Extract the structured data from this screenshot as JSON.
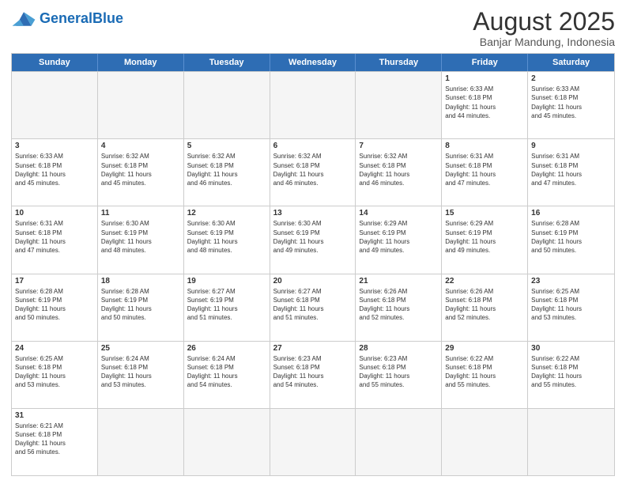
{
  "header": {
    "logo_general": "General",
    "logo_blue": "Blue",
    "calendar_title": "August 2025",
    "calendar_subtitle": "Banjar Mandung, Indonesia"
  },
  "days_of_week": [
    "Sunday",
    "Monday",
    "Tuesday",
    "Wednesday",
    "Thursday",
    "Friday",
    "Saturday"
  ],
  "weeks": [
    [
      {
        "day": "",
        "info": "",
        "empty": true
      },
      {
        "day": "",
        "info": "",
        "empty": true
      },
      {
        "day": "",
        "info": "",
        "empty": true
      },
      {
        "day": "",
        "info": "",
        "empty": true
      },
      {
        "day": "",
        "info": "",
        "empty": true
      },
      {
        "day": "1",
        "info": "Sunrise: 6:33 AM\nSunset: 6:18 PM\nDaylight: 11 hours\nand 44 minutes."
      },
      {
        "day": "2",
        "info": "Sunrise: 6:33 AM\nSunset: 6:18 PM\nDaylight: 11 hours\nand 45 minutes."
      }
    ],
    [
      {
        "day": "3",
        "info": "Sunrise: 6:33 AM\nSunset: 6:18 PM\nDaylight: 11 hours\nand 45 minutes."
      },
      {
        "day": "4",
        "info": "Sunrise: 6:32 AM\nSunset: 6:18 PM\nDaylight: 11 hours\nand 45 minutes."
      },
      {
        "day": "5",
        "info": "Sunrise: 6:32 AM\nSunset: 6:18 PM\nDaylight: 11 hours\nand 46 minutes."
      },
      {
        "day": "6",
        "info": "Sunrise: 6:32 AM\nSunset: 6:18 PM\nDaylight: 11 hours\nand 46 minutes."
      },
      {
        "day": "7",
        "info": "Sunrise: 6:32 AM\nSunset: 6:18 PM\nDaylight: 11 hours\nand 46 minutes."
      },
      {
        "day": "8",
        "info": "Sunrise: 6:31 AM\nSunset: 6:18 PM\nDaylight: 11 hours\nand 47 minutes."
      },
      {
        "day": "9",
        "info": "Sunrise: 6:31 AM\nSunset: 6:18 PM\nDaylight: 11 hours\nand 47 minutes."
      }
    ],
    [
      {
        "day": "10",
        "info": "Sunrise: 6:31 AM\nSunset: 6:18 PM\nDaylight: 11 hours\nand 47 minutes."
      },
      {
        "day": "11",
        "info": "Sunrise: 6:30 AM\nSunset: 6:19 PM\nDaylight: 11 hours\nand 48 minutes."
      },
      {
        "day": "12",
        "info": "Sunrise: 6:30 AM\nSunset: 6:19 PM\nDaylight: 11 hours\nand 48 minutes."
      },
      {
        "day": "13",
        "info": "Sunrise: 6:30 AM\nSunset: 6:19 PM\nDaylight: 11 hours\nand 49 minutes."
      },
      {
        "day": "14",
        "info": "Sunrise: 6:29 AM\nSunset: 6:19 PM\nDaylight: 11 hours\nand 49 minutes."
      },
      {
        "day": "15",
        "info": "Sunrise: 6:29 AM\nSunset: 6:19 PM\nDaylight: 11 hours\nand 49 minutes."
      },
      {
        "day": "16",
        "info": "Sunrise: 6:28 AM\nSunset: 6:19 PM\nDaylight: 11 hours\nand 50 minutes."
      }
    ],
    [
      {
        "day": "17",
        "info": "Sunrise: 6:28 AM\nSunset: 6:19 PM\nDaylight: 11 hours\nand 50 minutes."
      },
      {
        "day": "18",
        "info": "Sunrise: 6:28 AM\nSunset: 6:19 PM\nDaylight: 11 hours\nand 50 minutes."
      },
      {
        "day": "19",
        "info": "Sunrise: 6:27 AM\nSunset: 6:19 PM\nDaylight: 11 hours\nand 51 minutes."
      },
      {
        "day": "20",
        "info": "Sunrise: 6:27 AM\nSunset: 6:18 PM\nDaylight: 11 hours\nand 51 minutes."
      },
      {
        "day": "21",
        "info": "Sunrise: 6:26 AM\nSunset: 6:18 PM\nDaylight: 11 hours\nand 52 minutes."
      },
      {
        "day": "22",
        "info": "Sunrise: 6:26 AM\nSunset: 6:18 PM\nDaylight: 11 hours\nand 52 minutes."
      },
      {
        "day": "23",
        "info": "Sunrise: 6:25 AM\nSunset: 6:18 PM\nDaylight: 11 hours\nand 53 minutes."
      }
    ],
    [
      {
        "day": "24",
        "info": "Sunrise: 6:25 AM\nSunset: 6:18 PM\nDaylight: 11 hours\nand 53 minutes."
      },
      {
        "day": "25",
        "info": "Sunrise: 6:24 AM\nSunset: 6:18 PM\nDaylight: 11 hours\nand 53 minutes."
      },
      {
        "day": "26",
        "info": "Sunrise: 6:24 AM\nSunset: 6:18 PM\nDaylight: 11 hours\nand 54 minutes."
      },
      {
        "day": "27",
        "info": "Sunrise: 6:23 AM\nSunset: 6:18 PM\nDaylight: 11 hours\nand 54 minutes."
      },
      {
        "day": "28",
        "info": "Sunrise: 6:23 AM\nSunset: 6:18 PM\nDaylight: 11 hours\nand 55 minutes."
      },
      {
        "day": "29",
        "info": "Sunrise: 6:22 AM\nSunset: 6:18 PM\nDaylight: 11 hours\nand 55 minutes."
      },
      {
        "day": "30",
        "info": "Sunrise: 6:22 AM\nSunset: 6:18 PM\nDaylight: 11 hours\nand 55 minutes."
      }
    ],
    [
      {
        "day": "31",
        "info": "Sunrise: 6:21 AM\nSunset: 6:18 PM\nDaylight: 11 hours\nand 56 minutes."
      },
      {
        "day": "",
        "info": "",
        "empty": true
      },
      {
        "day": "",
        "info": "",
        "empty": true
      },
      {
        "day": "",
        "info": "",
        "empty": true
      },
      {
        "day": "",
        "info": "",
        "empty": true
      },
      {
        "day": "",
        "info": "",
        "empty": true
      },
      {
        "day": "",
        "info": "",
        "empty": true
      }
    ]
  ]
}
